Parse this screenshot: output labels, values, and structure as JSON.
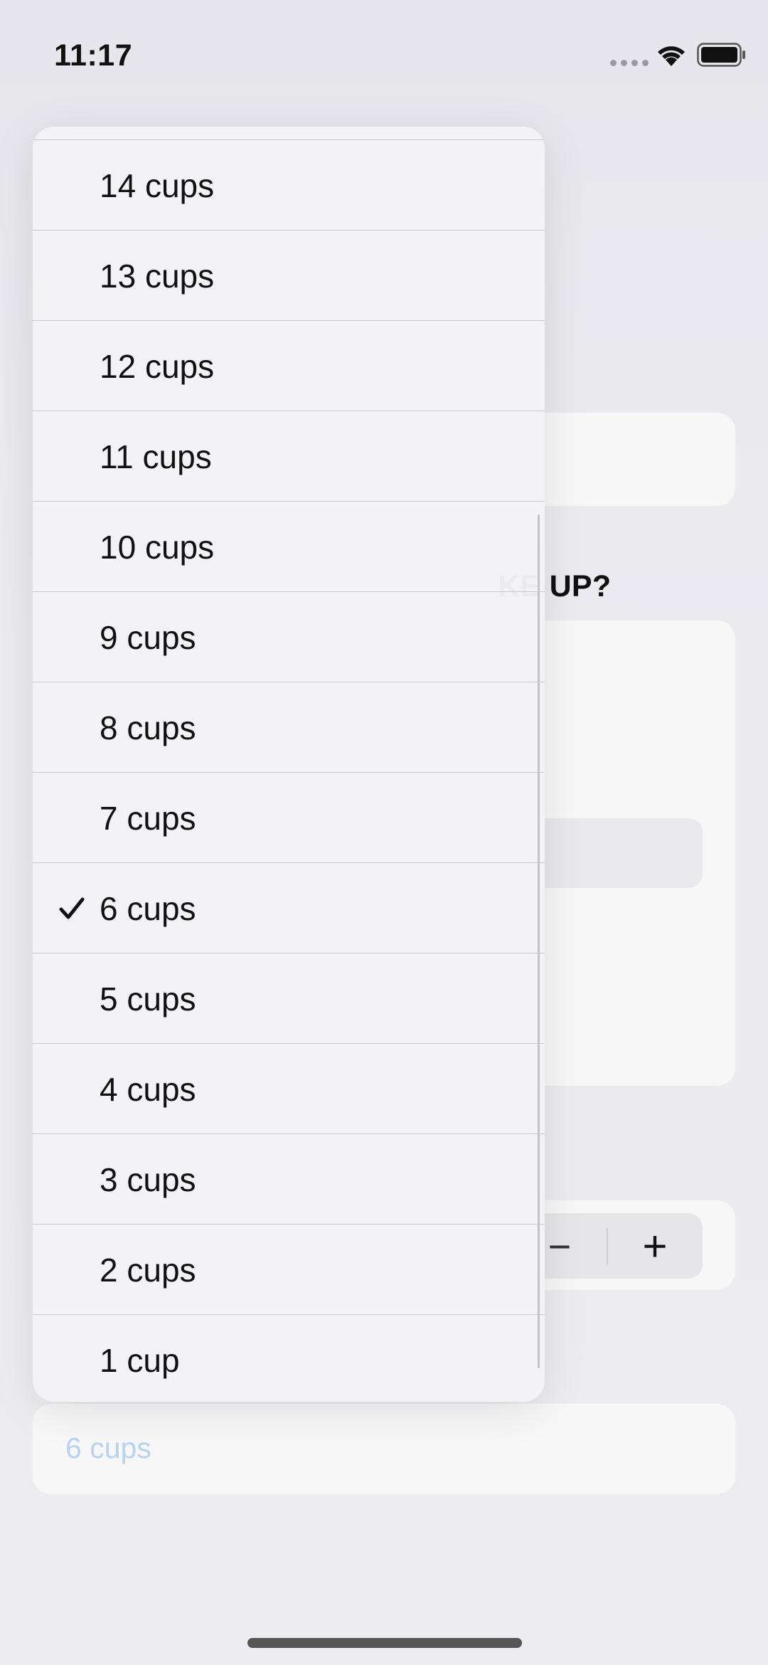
{
  "status_bar": {
    "time": "11:17"
  },
  "background_form": {
    "section_heading_partial": "KE UP?",
    "stepper": {
      "minus": "−",
      "plus": "+"
    },
    "selected_field_value": "6 cups"
  },
  "menu": {
    "items": [
      {
        "label": "14 cups",
        "checked": false
      },
      {
        "label": "13 cups",
        "checked": false
      },
      {
        "label": "12 cups",
        "checked": false
      },
      {
        "label": "11 cups",
        "checked": false
      },
      {
        "label": "10 cups",
        "checked": false
      },
      {
        "label": "9 cups",
        "checked": false
      },
      {
        "label": "8 cups",
        "checked": false
      },
      {
        "label": "7 cups",
        "checked": false
      },
      {
        "label": "6 cups",
        "checked": true
      },
      {
        "label": "5 cups",
        "checked": false
      },
      {
        "label": "4 cups",
        "checked": false
      },
      {
        "label": "3 cups",
        "checked": false
      },
      {
        "label": "2 cups",
        "checked": false
      },
      {
        "label": "1 cup",
        "checked": false
      }
    ]
  },
  "colors": {
    "accent_placeholder": "#b9d3ee",
    "menu_background": "#f3f3f5",
    "separator": "#c9c9cd"
  },
  "icons": {
    "wifi": "wifi-icon",
    "battery": "battery-icon",
    "checkmark": "checkmark-icon"
  }
}
